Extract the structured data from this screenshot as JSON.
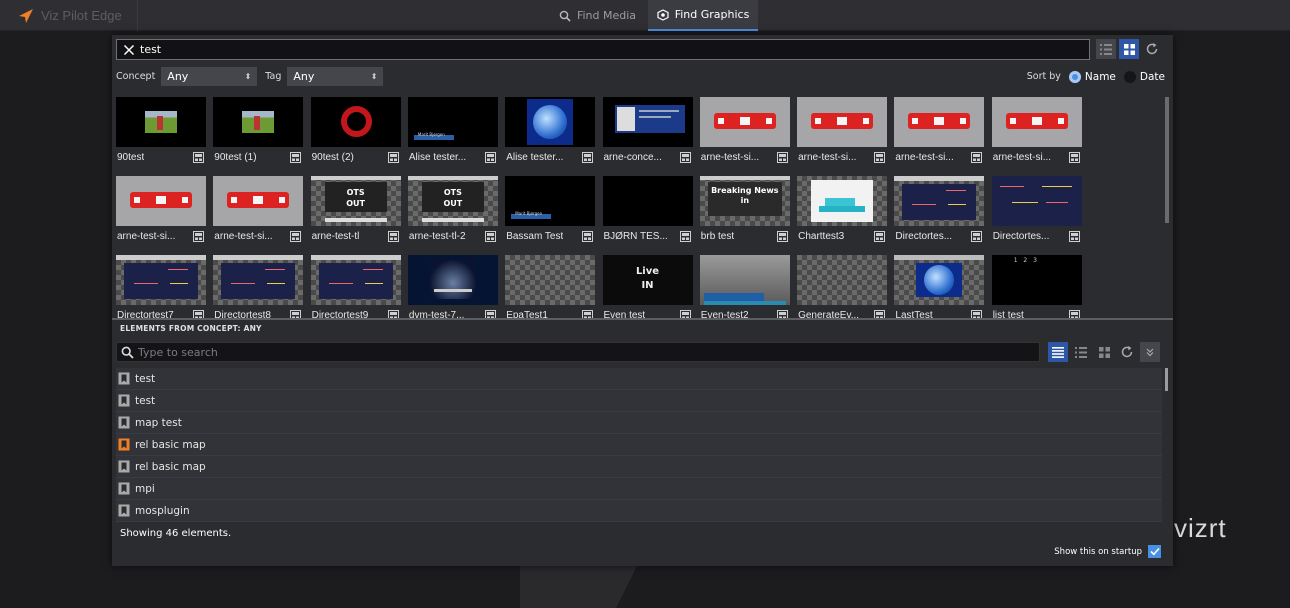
{
  "app": {
    "title": "Viz Pilot Edge",
    "brand_color": "#f07f28"
  },
  "top_tabs": [
    {
      "label": "Find Media",
      "icon": "search-icon"
    },
    {
      "label": "Find Graphics",
      "icon": "graphics-icon",
      "active": true
    }
  ],
  "search": {
    "value": "test"
  },
  "filters": {
    "concept_label": "Concept",
    "concept_value": "Any",
    "tag_label": "Tag",
    "tag_value": "Any"
  },
  "sort": {
    "label": "Sort by",
    "options": [
      "Name",
      "Date"
    ],
    "selected": "Name"
  },
  "thumbnails": [
    {
      "name": "90test"
    },
    {
      "name": "90test (1)"
    },
    {
      "name": "90test (2)"
    },
    {
      "name": "Alise tester...",
      "caption": "Marit Bjørgen"
    },
    {
      "name": "Alise tester..."
    },
    {
      "name": "arne-conce..."
    },
    {
      "name": "arne-test-si..."
    },
    {
      "name": "arne-test-si..."
    },
    {
      "name": "arne-test-si..."
    },
    {
      "name": "arne-test-si..."
    },
    {
      "name": "arne-test-si..."
    },
    {
      "name": "arne-test-si..."
    },
    {
      "name": "arne-test-tl",
      "caption": "OTS OUT"
    },
    {
      "name": "arne-test-tl-2",
      "caption": "OTS OUT"
    },
    {
      "name": "Bassam Test",
      "caption": "Marit Bjørgen"
    },
    {
      "name": "BJØRN TES..."
    },
    {
      "name": "brb test",
      "caption": "Breaking News in"
    },
    {
      "name": "Charttest3"
    },
    {
      "name": "Directortes..."
    },
    {
      "name": "Directortes..."
    },
    {
      "name": "Directortest7"
    },
    {
      "name": "Directortest8"
    },
    {
      "name": "Directortest9"
    },
    {
      "name": "dvm-test-7..."
    },
    {
      "name": "EpaTest1"
    },
    {
      "name": "Even test",
      "caption": "Live IN"
    },
    {
      "name": "Even-test2"
    },
    {
      "name": "GenerateEv..."
    },
    {
      "name": "LastTest"
    },
    {
      "name": "list test",
      "caption": "1 2 3"
    }
  ],
  "elements": {
    "header": "ELEMENTS FROM CONCEPT: ANY",
    "search_placeholder": "Type to search",
    "items": [
      {
        "label": "test",
        "icon": "bookmark-icon",
        "color": "#aaaaaa"
      },
      {
        "label": "test",
        "icon": "bookmark-icon",
        "color": "#aaaaaa"
      },
      {
        "label": "map test",
        "icon": "bookmark-icon",
        "color": "#aaaaaa"
      },
      {
        "label": "rel basic map",
        "icon": "bookmark-icon",
        "color": "#f07f28"
      },
      {
        "label": "rel basic map",
        "icon": "bookmark-icon",
        "color": "#aaaaaa"
      },
      {
        "label": "mpi",
        "icon": "bookmark-icon",
        "color": "#aaaaaa"
      },
      {
        "label": "mosplugin",
        "icon": "bookmark-icon",
        "color": "#aaaaaa"
      }
    ]
  },
  "footer": {
    "status": "Showing 46 elements.",
    "startup_label": "Show this on startup",
    "startup_checked": true
  },
  "watermark": "vizrt"
}
